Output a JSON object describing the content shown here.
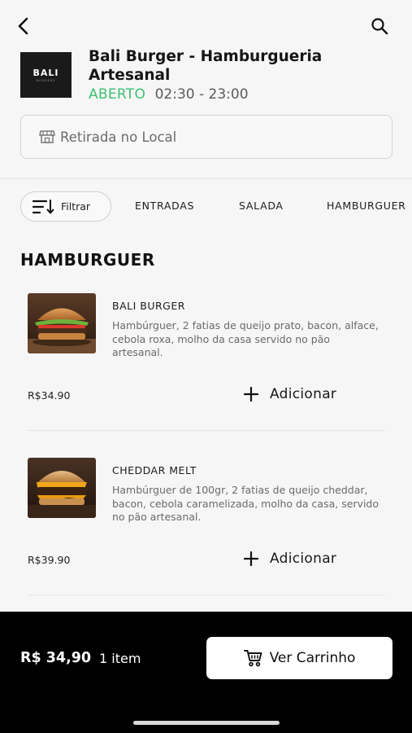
{
  "store": {
    "logo_text": "BALI",
    "logo_subtext": "BURGERS",
    "name": "Bali Burger - Hamburgueria Artesanal",
    "status": "ABERTO",
    "hours": "02:30 - 23:00"
  },
  "pickup": {
    "label": "Retirada no Local"
  },
  "filters": {
    "filter_label": "Filtrar",
    "categories": [
      "ENTRADAS",
      "SALADA",
      "HAMBURGUER"
    ]
  },
  "section": {
    "title": "HAMBURGUER"
  },
  "products": [
    {
      "name": "BALI BURGER",
      "description": "Hambúrguer, 2 fatias de queijo prato, bacon, alface, cebola roxa, molho da casa servido no pão artesanal.",
      "price": "R$34.90",
      "add_label": "Adicionar"
    },
    {
      "name": "CHEDDAR MELT",
      "description": "Hambúrguer de 100gr, 2 fatias de queijo cheddar, bacon, cebola caramelizada, molho da casa, servido no pão artesanal.",
      "price": "R$39.90",
      "add_label": "Adicionar"
    }
  ],
  "cart": {
    "total": "R$ 34,90",
    "items": "1 item",
    "button_label": "Ver Carrinho"
  },
  "colors": {
    "open_status": "#3cc174",
    "cart_bar": "#000000"
  },
  "icons": {
    "back": "chevron-left-icon",
    "search": "search-icon",
    "store": "store-icon",
    "filter": "sort-icon",
    "add": "plus-icon",
    "cart": "cart-icon"
  }
}
